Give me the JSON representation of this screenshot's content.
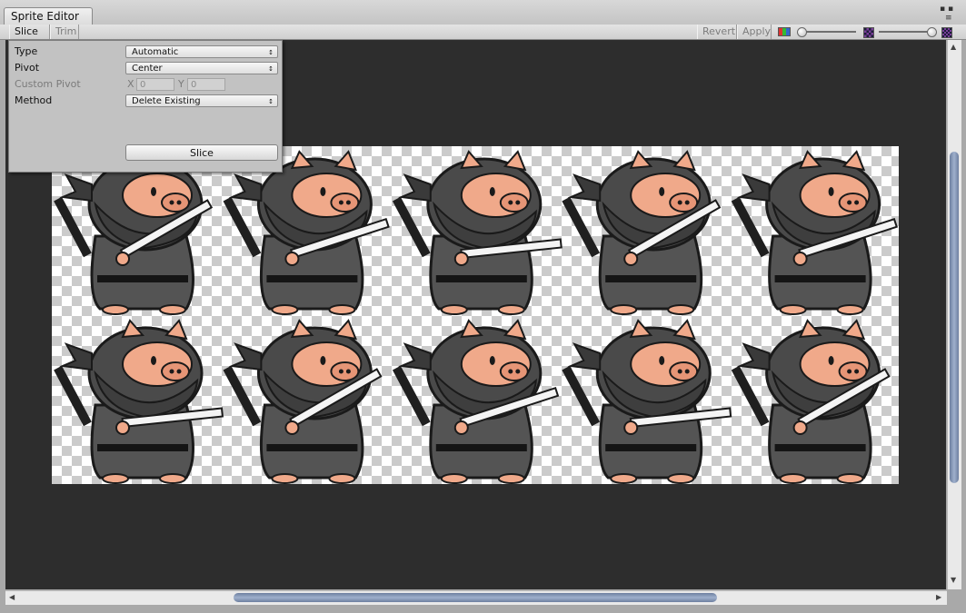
{
  "window": {
    "tab_title": "Sprite Editor",
    "controls": "▪ ▪",
    "menu_glyph": "≡"
  },
  "toolbar": {
    "slice_label": "Slice ♢",
    "trim_label": "Trim",
    "revert_label": "Revert",
    "apply_label": "Apply"
  },
  "slice_panel": {
    "type_label": "Type",
    "type_value": "Automatic",
    "pivot_label": "Pivot",
    "pivot_value": "Center",
    "custom_pivot_label": "Custom Pivot",
    "x_label": "X",
    "x_value": "0",
    "y_label": "Y",
    "y_value": "0",
    "method_label": "Method",
    "method_value": "Delete Existing",
    "slice_button": "Slice"
  },
  "icons": {
    "dropdown_arrow": "↕",
    "scroll_left": "◀",
    "scroll_right": "▶",
    "scroll_up": "▲",
    "scroll_down": "▼"
  },
  "colors": {
    "ninja_grey": "#4a4a4a",
    "pig_pink": "#f0a98a",
    "sword": "#f4f4f4",
    "scroll_thumb": "#8095b8"
  },
  "sprite_sheet": {
    "rows": 2,
    "columns": 5,
    "frame_count": 10
  }
}
